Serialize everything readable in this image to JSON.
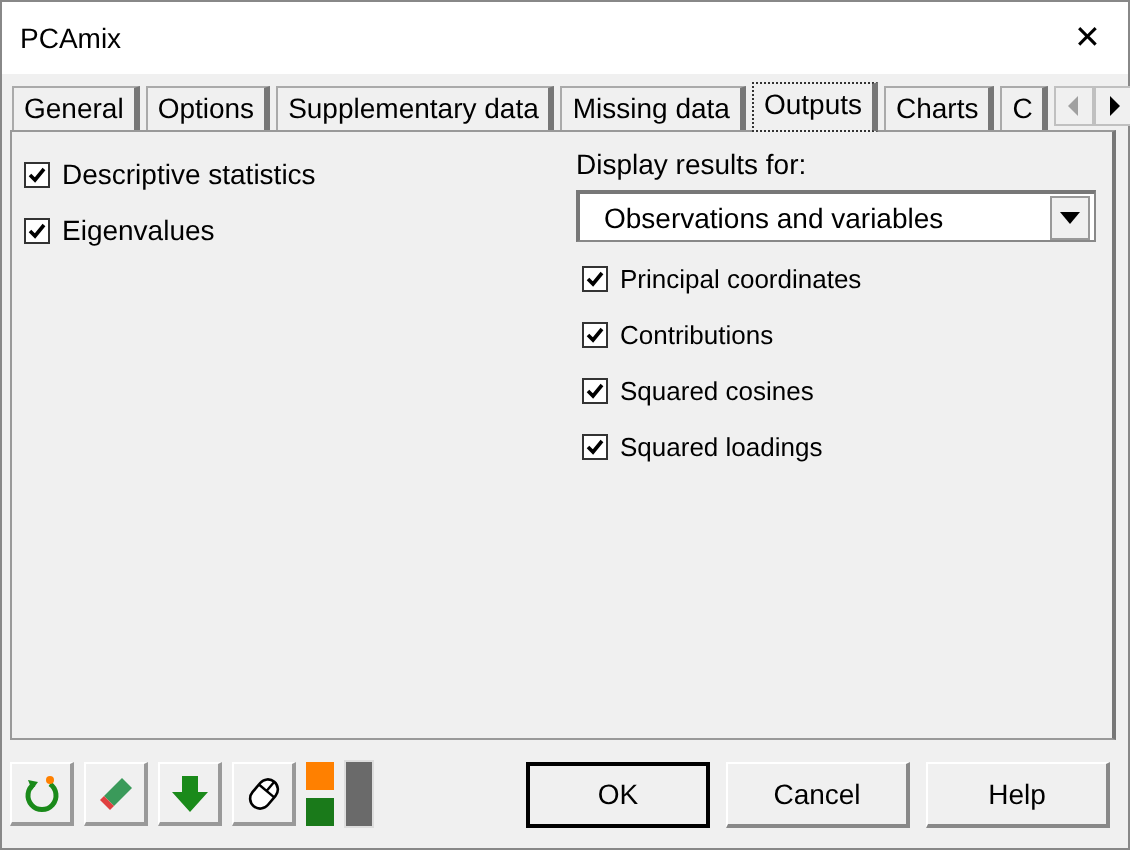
{
  "window": {
    "title": "PCAmix",
    "close": "✕"
  },
  "tabs": [
    {
      "label": "General",
      "selected": false
    },
    {
      "label": "Options",
      "selected": false
    },
    {
      "label": "Supplementary data",
      "selected": false
    },
    {
      "label": "Missing data",
      "selected": false
    },
    {
      "label": "Outputs",
      "selected": true
    },
    {
      "label": "Charts",
      "selected": false
    },
    {
      "label": "C",
      "selected": false
    }
  ],
  "left_options": [
    {
      "label": "Descriptive statistics",
      "checked": true
    },
    {
      "label": "Eigenvalues",
      "checked": true
    }
  ],
  "display_results": {
    "label": "Display results for:",
    "value": "Observations and variables"
  },
  "right_options": [
    {
      "label": "Principal coordinates",
      "checked": true
    },
    {
      "label": "Contributions",
      "checked": true
    },
    {
      "label": "Squared cosines",
      "checked": true
    },
    {
      "label": "Squared loadings",
      "checked": true
    }
  ],
  "buttons": [
    "OK",
    "Cancel",
    "Help"
  ]
}
